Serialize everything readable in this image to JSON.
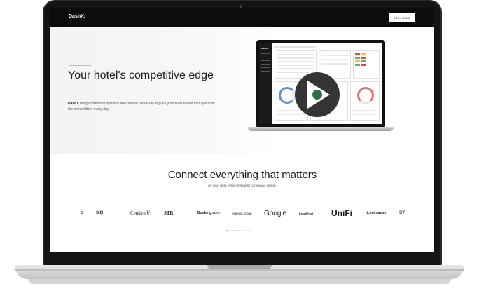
{
  "nav": {
    "logo": "DashX.",
    "cta_label": "BOOK DEMO"
  },
  "hero": {
    "title": "Your hotel's competitive edge",
    "description_brand": "DashX",
    "description_rest": " brings combines systems and data to create the signals your hotel needs to outperform the competition, every day.",
    "video_logo": "DashX."
  },
  "connect": {
    "title": "Connect everything that matters",
    "subtitle": "All your data. One intelligent command centre."
  },
  "brands": [
    {
      "label": "S",
      "icon": "partial-logo"
    },
    {
      "label": "SIQ",
      "icon": "siq-logo"
    },
    {
      "label": "CendynⓇ",
      "icon": "cendyn-logo"
    },
    {
      "label": "STR",
      "icon": "str-logo"
    },
    {
      "label": "Booking.com",
      "icon": "booking-logo"
    },
    {
      "label": "expedia group",
      "icon": "expedia-logo"
    },
    {
      "label": "Google",
      "icon": "google-logo"
    },
    {
      "label": "FreeWheel",
      "icon": "freewheel-logo"
    },
    {
      "label": "UniFi",
      "icon": "unifi-logo"
    },
    {
      "label": "ticketmaster",
      "icon": "ticketmaster-logo"
    },
    {
      "label": "SY",
      "icon": "partial-logo"
    }
  ],
  "carousel": {
    "count": 9,
    "active": 0
  },
  "colors": {
    "nav_bg": "#0c0c0c",
    "text_dark": "#1b1b1b",
    "play_accent": "#2e6d46"
  }
}
